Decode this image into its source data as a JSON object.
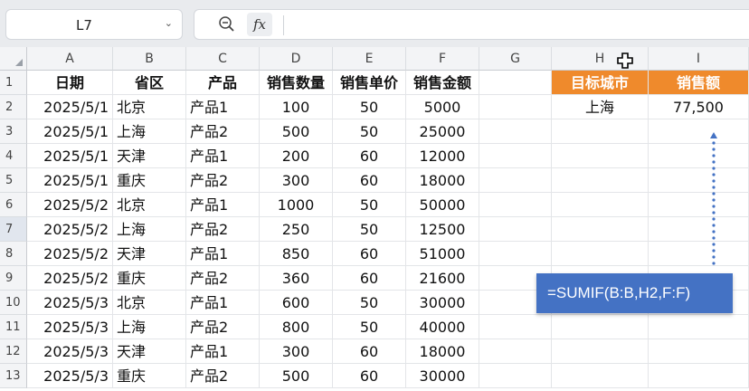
{
  "name_box": {
    "value": "L7"
  },
  "formula_bar": {
    "fx_label": "fx",
    "value": ""
  },
  "columns": [
    "A",
    "B",
    "C",
    "D",
    "E",
    "F",
    "G",
    "H",
    "I"
  ],
  "rows": [
    "1",
    "2",
    "3",
    "4",
    "5",
    "6",
    "7",
    "8",
    "9",
    "10",
    "11",
    "12",
    "13"
  ],
  "selected_row": "7",
  "headers": [
    "日期",
    "省区",
    "产品",
    "销售数量",
    "销售单价",
    "销售金额"
  ],
  "data_rows": [
    [
      "2025/5/1",
      "北京",
      "产品1",
      "100",
      "50",
      "5000"
    ],
    [
      "2025/5/1",
      "上海",
      "产品2",
      "500",
      "50",
      "25000"
    ],
    [
      "2025/5/1",
      "天津",
      "产品1",
      "200",
      "60",
      "12000"
    ],
    [
      "2025/5/1",
      "重庆",
      "产品2",
      "300",
      "60",
      "18000"
    ],
    [
      "2025/5/2",
      "北京",
      "产品1",
      "1000",
      "50",
      "50000"
    ],
    [
      "2025/5/2",
      "上海",
      "产品2",
      "250",
      "50",
      "12500"
    ],
    [
      "2025/5/2",
      "天津",
      "产品1",
      "850",
      "60",
      "51000"
    ],
    [
      "2025/5/2",
      "重庆",
      "产品2",
      "360",
      "60",
      "21600"
    ],
    [
      "2025/5/3",
      "北京",
      "产品1",
      "600",
      "50",
      "30000"
    ],
    [
      "2025/5/3",
      "上海",
      "产品2",
      "800",
      "50",
      "40000"
    ],
    [
      "2025/5/3",
      "天津",
      "产品1",
      "300",
      "60",
      "18000"
    ],
    [
      "2025/5/3",
      "重庆",
      "产品2",
      "500",
      "60",
      "30000"
    ]
  ],
  "lookup": {
    "header_city": "目标城市",
    "header_sales": "销售额",
    "city": "上海",
    "sales": "77,500"
  },
  "annotation": {
    "formula": "=SUMIF(B:B,H2,F:F)"
  },
  "colors": {
    "header_orange": "#ef8a2c",
    "tip_blue": "#4472c4",
    "dots_blue": "#4472c4"
  }
}
